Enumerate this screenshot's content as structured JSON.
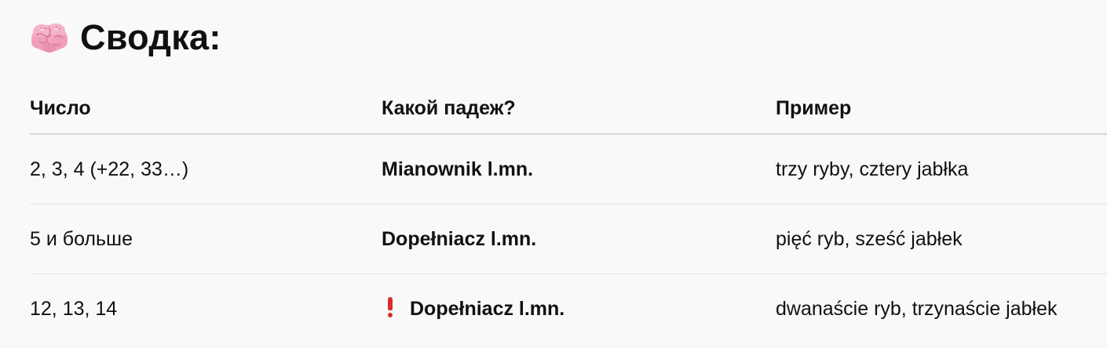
{
  "heading": {
    "icon": "brain-icon",
    "title": "Сводка:"
  },
  "table": {
    "headers": [
      "Число",
      "Какой падеж?",
      "Пример"
    ],
    "rows": [
      {
        "number": "2, 3, 4 (+22, 33…)",
        "case": "Mianownik l.mn.",
        "example": "trzy ryby, cztery jabłka",
        "warning": false
      },
      {
        "number": "5 и больше",
        "case": "Dopełniacz l.mn.",
        "example": "pięć ryb, sześć jabłek",
        "warning": false
      },
      {
        "number": "12, 13, 14",
        "case": "Dopełniacz l.mn.",
        "example": "dwanaście ryb, trzynaście jabłek",
        "warning": true,
        "warning_icon": "exclamation-icon"
      }
    ]
  },
  "colors": {
    "background": "#f9f9f9",
    "text": "#111111",
    "warning": "#d3312a",
    "brain": "#f3a7bf"
  }
}
